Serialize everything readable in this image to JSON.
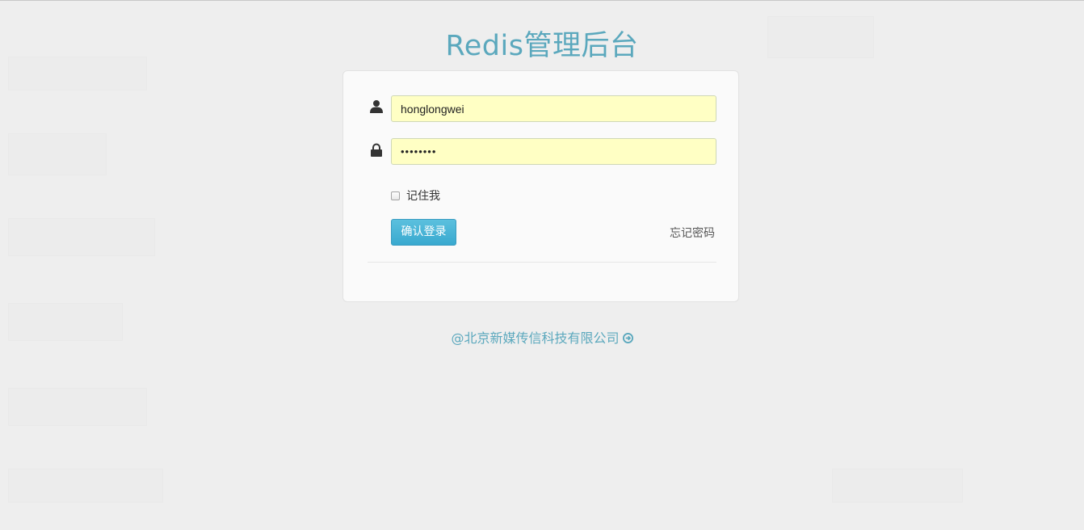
{
  "page": {
    "title": "Redis管理后台"
  },
  "login_form": {
    "username_value": "honglongwei",
    "password_value": "••••••••",
    "remember_label": "记住我",
    "remember_checked": false,
    "submit_label": "确认登录",
    "forgot_label": "忘记密码"
  },
  "footer": {
    "company_link": "@北京新媒传信科技有限公司"
  },
  "icons": {
    "username": "user-icon",
    "password": "lock-icon",
    "footer": "arrow-circle-right-icon"
  },
  "colors": {
    "background": "#eeeeee",
    "accent": "#5ba8bd",
    "input_autofill": "#ffffc4",
    "button": "#39a9cf"
  }
}
